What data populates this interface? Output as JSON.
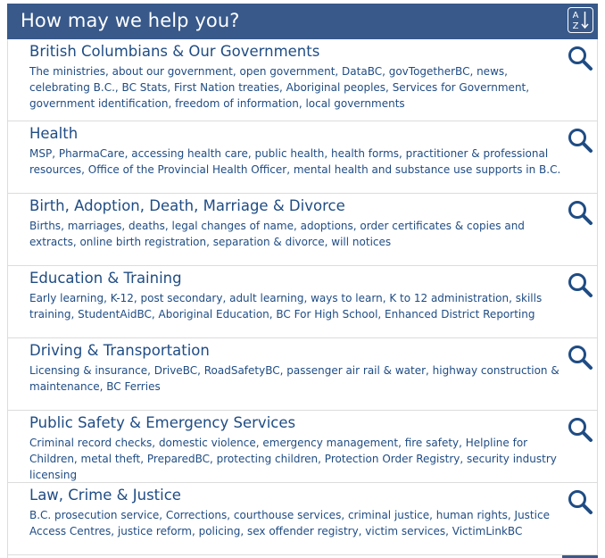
{
  "header": {
    "title": "How may we help you?",
    "sort_icon": "az-sort-icon",
    "sort_letters": [
      "A",
      "Z"
    ]
  },
  "colors": {
    "header_bg": "#38598a",
    "link_text": "#1f4c84",
    "divider": "#dcdcdc"
  },
  "categories": [
    {
      "title": "British Columbians & Our Governments",
      "description": "The ministries, about our government, open government, DataBC, govTogetherBC, news, celebrating B.C., BC Stats, First Nation treaties, Aboriginal peoples, Services for Government, government identification, freedom of information, local governments",
      "icon": "search-icon"
    },
    {
      "title": "Health",
      "description": "MSP, PharmaCare, accessing health care, public health, health forms, practitioner & professional resources, Office of the Provincial Health Officer, mental health and substance use supports in B.C.",
      "icon": "search-icon"
    },
    {
      "title": "Birth, Adoption, Death, Marriage & Divorce",
      "description": "Births, marriages, deaths, legal changes of name, adoptions, order certificates & copies and extracts, online birth registration, separation & divorce, will notices",
      "icon": "search-icon"
    },
    {
      "title": "Education & Training",
      "description": "Early learning, K-12, post secondary, adult learning, ways to learn, K to 12 administration, skills training, StudentAidBC, Aboriginal Education, BC For High School, Enhanced District Reporting",
      "icon": "search-icon"
    },
    {
      "title": "Driving & Transportation",
      "description": "Licensing & insurance, DriveBC, RoadSafetyBC, passenger air rail & water, highway construction & maintenance, BC Ferries",
      "icon": "search-icon"
    },
    {
      "title": "Public Safety & Emergency Services",
      "description": "Criminal record checks, domestic violence, emergency management, fire safety, Helpline for Children, metal theft, PreparedBC, protecting children, Protection Order Registry, security industry licensing",
      "icon": "search-icon"
    },
    {
      "title": "Law, Crime & Justice",
      "description": "B.C. prosecution service, Corrections, courthouse services, criminal justice, human rights, Justice Access Centres, justice reform, policing, sex offender registry, victim services, VictimLinkBC",
      "icon": "search-icon"
    }
  ]
}
